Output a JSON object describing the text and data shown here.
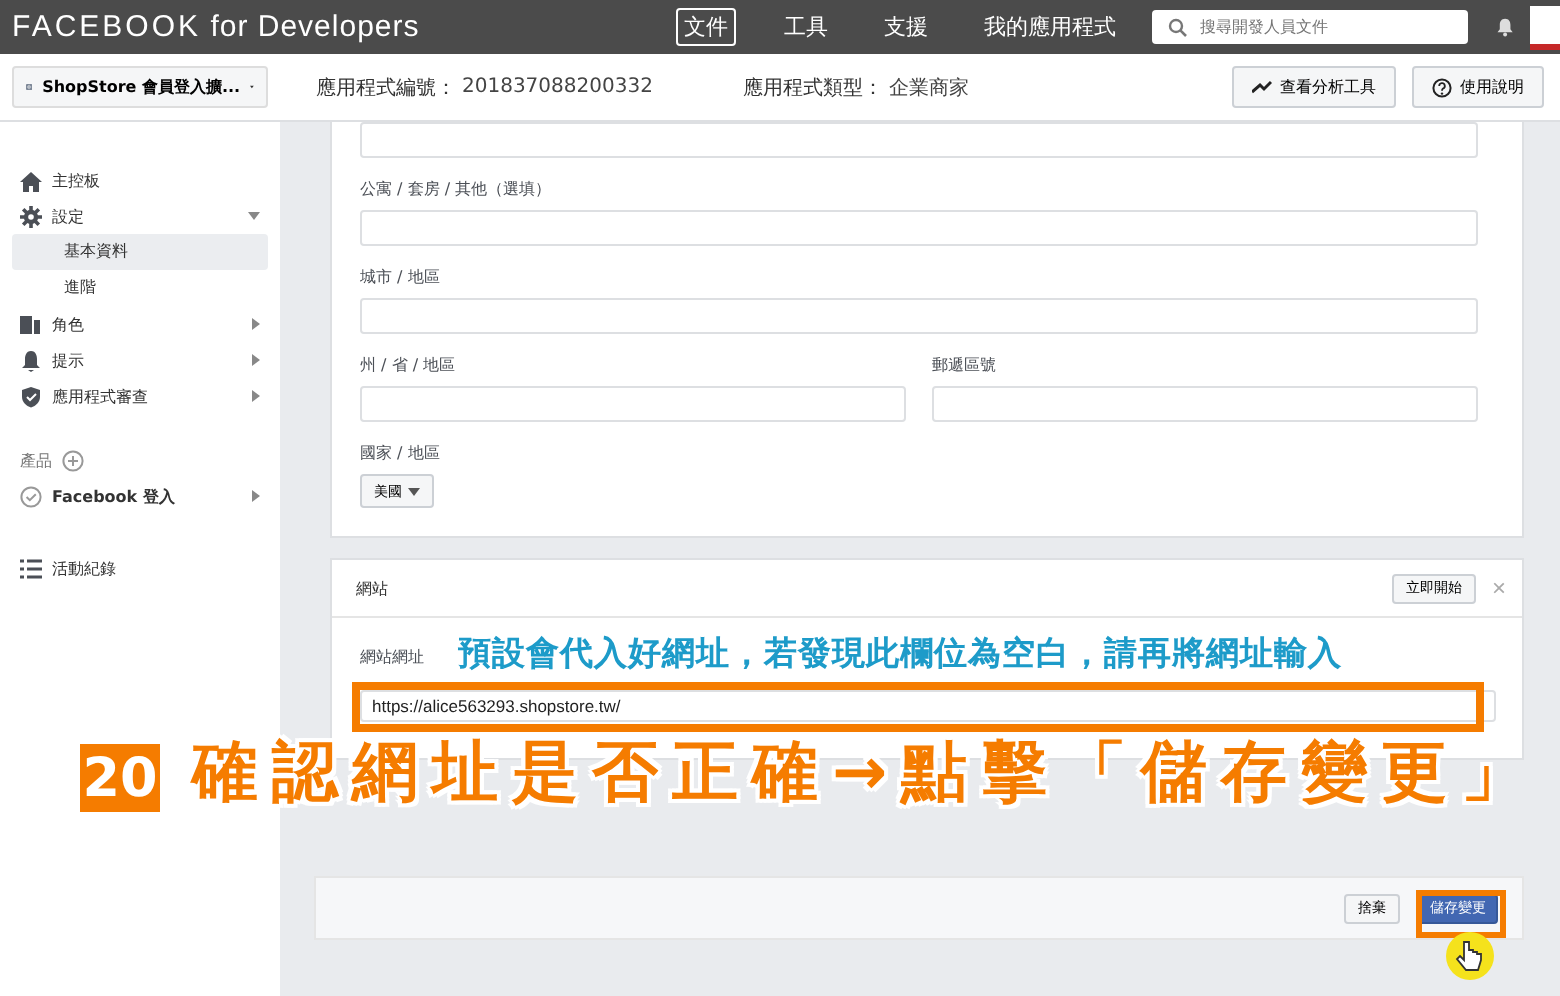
{
  "top_bar": {
    "logo": "FACEBOOK",
    "logo_suffix": "for Developers",
    "nav": [
      {
        "label": "文件",
        "selected": true
      },
      {
        "label": "工具",
        "selected": false
      },
      {
        "label": "支援",
        "selected": false
      },
      {
        "label": "我的應用程式",
        "selected": false
      }
    ],
    "search": {
      "placeholder": "搜尋開發人員文件"
    }
  },
  "header": {
    "app_selector": "ShopStore 會員登入擴...",
    "app_id_label": "應用程式編號：",
    "app_id": "201837088200332",
    "app_type_label": "應用程式類型：",
    "app_type": "企業商家",
    "buttons": [
      "查看分析工具",
      "使用說明"
    ]
  },
  "sidebar": {
    "items": [
      {
        "kind": "link",
        "label": "主控板",
        "selected": false
      },
      {
        "kind": "group",
        "label": "設定",
        "expanded": true,
        "children": [
          {
            "label": "基本資料",
            "selected": true
          },
          {
            "label": "進階",
            "selected": false
          }
        ]
      },
      {
        "kind": "group",
        "label": "角色",
        "expanded": false
      },
      {
        "kind": "group",
        "label": "提示",
        "expanded": false
      },
      {
        "kind": "group",
        "label": "應用程式審查",
        "expanded": false
      },
      {
        "kind": "section",
        "label": "產品"
      },
      {
        "kind": "product",
        "label": "Facebook 登入",
        "expanded": false
      },
      {
        "kind": "spacer"
      },
      {
        "kind": "link",
        "label": "活動紀錄",
        "selected": false
      }
    ]
  },
  "address_form": {
    "fields": [
      {
        "kind": "full",
        "label": "公寓 / 套房 / 其他（選填）"
      },
      {
        "kind": "full",
        "label": "城市 / 地區"
      },
      {
        "kind": "pair",
        "labels": [
          "州 / 省 / 地區",
          "郵遞區號"
        ]
      },
      {
        "kind": "select",
        "label": "國家 / 地區",
        "value": "美國"
      }
    ]
  },
  "website_card": {
    "title": "網站",
    "start_button": "立即開始",
    "close": "×",
    "field_label": "網站網址",
    "field_value": "https://alice563293.shopstore.tw/"
  },
  "footer": {
    "discard": "捨棄",
    "save": "儲存變更"
  },
  "annotations": {
    "hint": "預設會代入好網址，若發現此欄位為空白，請再將網址輸入",
    "step": "20",
    "instruction": "確認網址是否正確→點擊「儲存變更」"
  }
}
